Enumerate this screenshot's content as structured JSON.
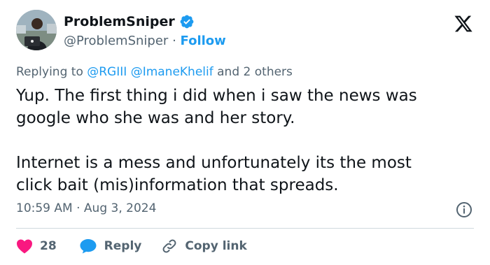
{
  "tweet": {
    "author": {
      "name": "ProblemSniper",
      "handle": "@ProblemSniper",
      "follow_label": "Follow"
    },
    "replying": {
      "prefix": "Replying to",
      "mentions": [
        "@RGIII",
        "@ImaneKhelif"
      ],
      "suffix": "and 2 others"
    },
    "text": {
      "paragraph1_line1": "Yup. The first thing i did when i saw the news was",
      "paragraph1_line2": "google who she was and her story.",
      "paragraph2_line1": "Internet is a mess and unfortunately its the most",
      "paragraph2_line2": "click bait (mis)information that spreads."
    },
    "time": "10:59 AM",
    "date": "Aug 3, 2024",
    "separator": "·",
    "actions": {
      "likes_count": "28",
      "reply_label": "Reply",
      "copy_link_label": "Copy link"
    }
  },
  "colors": {
    "accent": "#1d9bf0",
    "like": "#f91880",
    "secondary_text": "#536471",
    "primary_text": "#0f1419"
  },
  "icons": [
    "verified-badge-icon",
    "x-logo-icon",
    "info-icon",
    "heart-icon",
    "reply-bubble-icon",
    "link-icon"
  ]
}
